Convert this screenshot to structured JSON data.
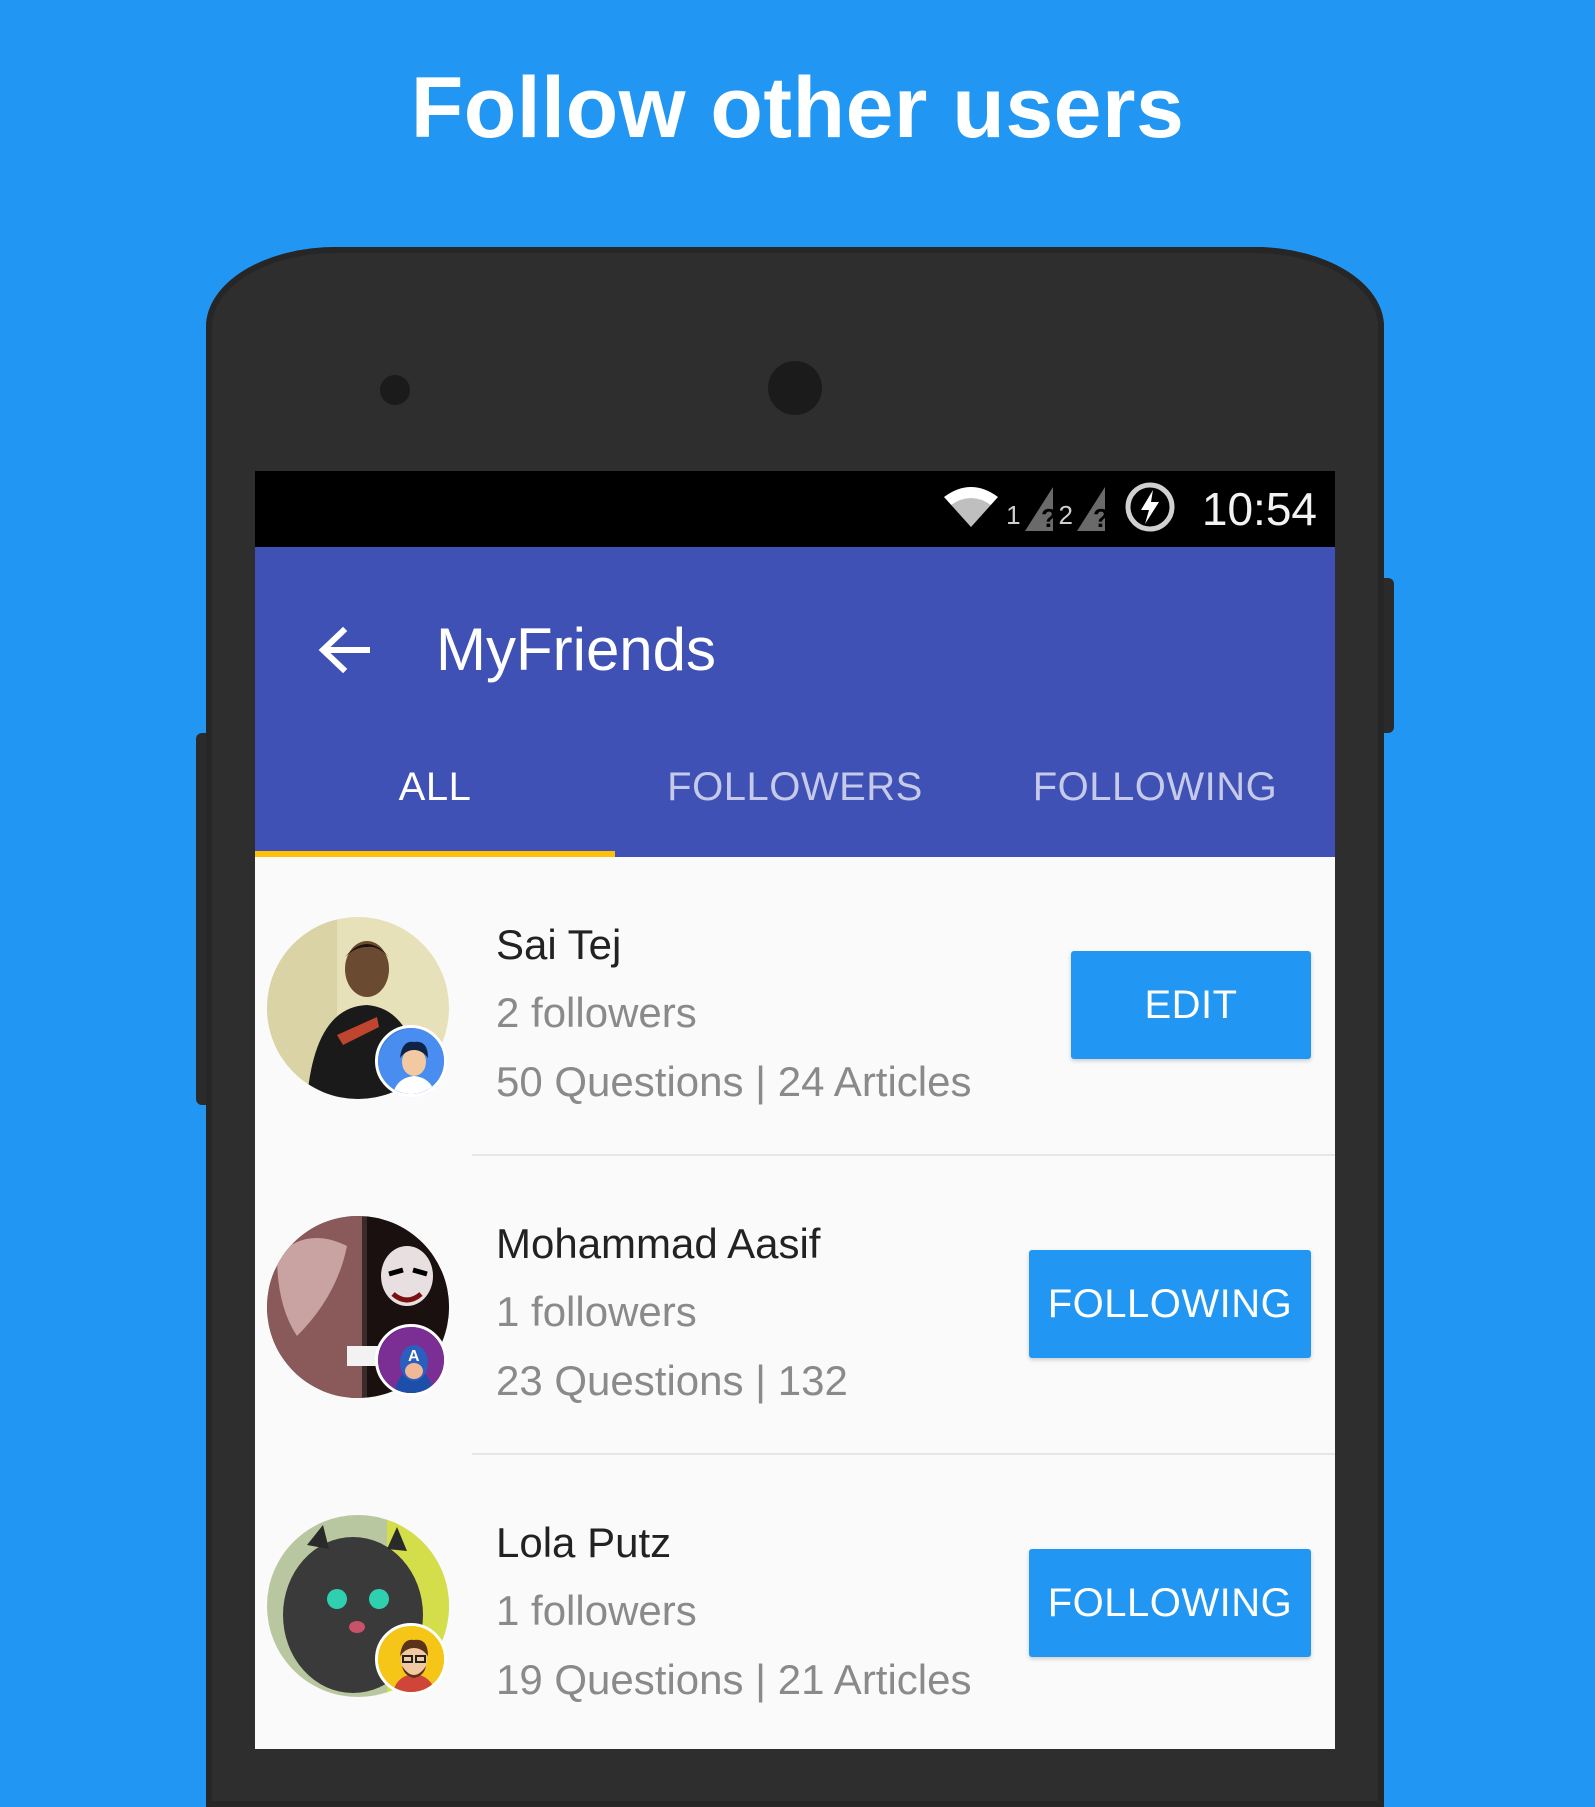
{
  "promo": {
    "title": "Follow other users"
  },
  "status_bar": {
    "time": "10:54",
    "sim1_label": "1",
    "sim2_label": "2",
    "icons": [
      "wifi-icon",
      "sim1-signal-icon",
      "sim2-signal-icon",
      "battery-charging-icon"
    ]
  },
  "app_bar": {
    "title": "MyFriends",
    "back_icon": "arrow-back-icon",
    "tabs": [
      {
        "label": "ALL",
        "active": true
      },
      {
        "label": "FOLLOWERS",
        "active": false
      },
      {
        "label": "FOLLOWING",
        "active": false
      }
    ]
  },
  "colors": {
    "background": "#2196f3",
    "app_bar": "#3f51b5",
    "tab_indicator": "#ffc107",
    "button": "#2196f3"
  },
  "users": [
    {
      "name": "Sai Tej",
      "followers": "2 followers",
      "stats": "50 Questions | 24 Articles",
      "action": "EDIT"
    },
    {
      "name": "Mohammad Aasif",
      "followers": "1 followers",
      "stats": "23 Questions | 132",
      "action": "FOLLOWING"
    },
    {
      "name": "Lola Putz",
      "followers": "1 followers",
      "stats": "19 Questions | 21 Articles",
      "action": "FOLLOWING"
    }
  ]
}
